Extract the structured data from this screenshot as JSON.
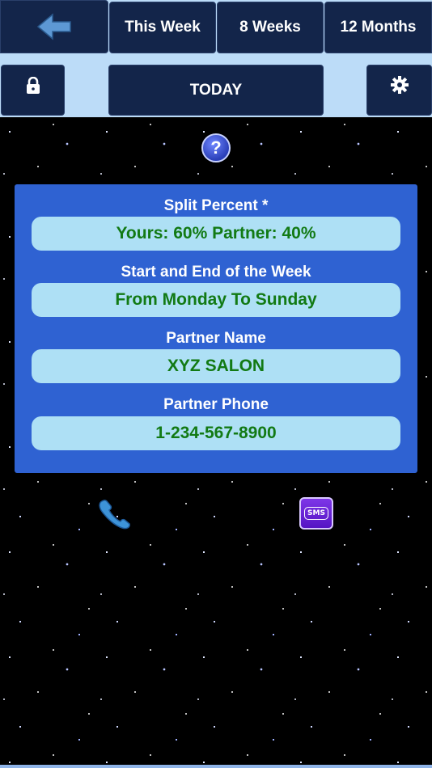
{
  "top_nav": {
    "back_icon": "arrow-left-icon",
    "this_week": "This Week",
    "eight_weeks": "8 Weeks",
    "twelve_months": "12 Months"
  },
  "second_bar": {
    "lock_icon": "lock-icon",
    "today": "TODAY",
    "gear_icon": "gear-icon"
  },
  "help": {
    "icon": "question-icon",
    "glyph": "?"
  },
  "settings": {
    "split_label": "Split Percent *",
    "split_value": "Yours: 60% Partner: 40%",
    "week_label": "Start and End of the Week",
    "week_value": "From Monday To Sunday",
    "partner_name_label": "Partner Name",
    "partner_name_value": "XYZ SALON",
    "partner_phone_label": "Partner Phone",
    "partner_phone_value": "1-234-567-8900"
  },
  "actions": {
    "call_icon": "phone-icon",
    "sms_icon": "sms-icon",
    "sms_text": "SMS"
  },
  "colors": {
    "nav_bg": "#13254a",
    "top_bg": "#bcdcf8",
    "panel_bg": "#2f62d2",
    "field_bg": "#aee0f5",
    "value_text": "#127a14"
  }
}
